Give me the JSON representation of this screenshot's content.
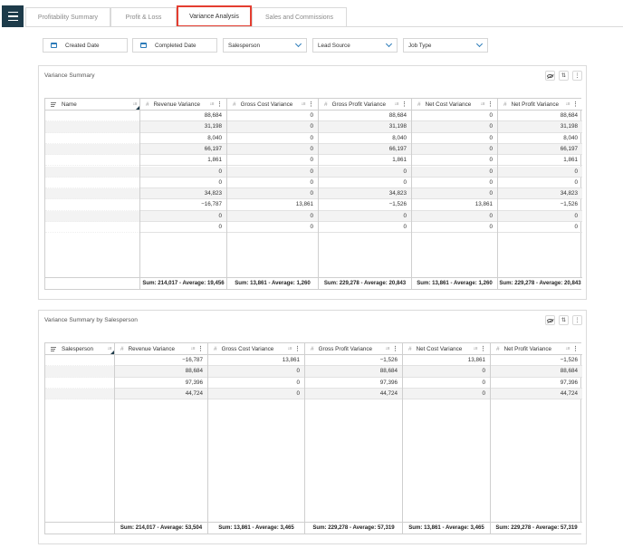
{
  "nav": {
    "tabs": [
      {
        "label": "Profitability Summary"
      },
      {
        "label": "Profit & Loss"
      },
      {
        "label": "Variance Analysis"
      },
      {
        "label": "Sales and Commissions"
      }
    ],
    "active_tab": "Variance Analysis"
  },
  "filters": {
    "created_date": "Created Date",
    "completed_date": "Completed Date",
    "salesperson": "Salesperson",
    "lead_source": "Lead Source",
    "job_type": "Job Type"
  },
  "variance_summary": {
    "title": "Variance Summary",
    "columns": [
      "Name",
      "Revenue Variance",
      "Gross Cost Variance",
      "Gross Profit Variance",
      "Net Cost Variance",
      "Net Profit Variance"
    ],
    "rows": [
      [
        "88,684",
        "0",
        "88,684",
        "0",
        "88,684"
      ],
      [
        "31,198",
        "0",
        "31,198",
        "0",
        "31,198"
      ],
      [
        "8,040",
        "0",
        "8,040",
        "0",
        "8,040"
      ],
      [
        "66,197",
        "0",
        "66,197",
        "0",
        "66,197"
      ],
      [
        "1,861",
        "0",
        "1,861",
        "0",
        "1,861"
      ],
      [
        "0",
        "0",
        "0",
        "0",
        "0"
      ],
      [
        "0",
        "0",
        "0",
        "0",
        "0"
      ],
      [
        "34,823",
        "0",
        "34,823",
        "0",
        "34,823"
      ],
      [
        "−16,787",
        "13,861",
        "−1,526",
        "13,861",
        "−1,526"
      ],
      [
        "0",
        "0",
        "0",
        "0",
        "0"
      ],
      [
        "0",
        "0",
        "0",
        "0",
        "0"
      ]
    ],
    "footer": [
      "Sum: 214,017 - Average: 19,456",
      "Sum: 13,861 - Average: 1,260",
      "Sum: 229,278 - Average: 20,843",
      "Sum: 13,861 - Average: 1,260",
      "Sum: 229,278 - Average: 20,843"
    ]
  },
  "variance_by_salesperson": {
    "title": "Variance Summary by Salesperson",
    "columns": [
      "Salesperson",
      "Revenue Variance",
      "Gross Cost Variance",
      "Gross Profit Variance",
      "Net Cost Variance",
      "Net Profit Variance"
    ],
    "rows": [
      [
        "−16,787",
        "13,861",
        "−1,526",
        "13,861",
        "−1,526"
      ],
      [
        "88,684",
        "0",
        "88,684",
        "0",
        "88,684"
      ],
      [
        "97,396",
        "0",
        "97,396",
        "0",
        "97,396"
      ],
      [
        "44,724",
        "0",
        "44,724",
        "0",
        "44,724"
      ]
    ],
    "footer": [
      "Sum: 214,017 - Average: 53,504",
      "Sum: 13,861 - Average: 3,465",
      "Sum: 229,278 - Average: 57,319",
      "Sum: 13,861 - Average: 3,465",
      "Sum: 229,278 - Average: 57,319"
    ]
  },
  "icons": {
    "menu": "hamburger-icon",
    "calendar": "calendar-icon",
    "dropdown": "chevron-down-icon",
    "hide": "eye-slash-icon",
    "sort": "sort-icon",
    "more": "more-vertical-icon"
  },
  "colors": {
    "accent": "#2a7ab8",
    "active_tab_border": "#e43d30",
    "menu_bg": "#1d3b4a"
  }
}
